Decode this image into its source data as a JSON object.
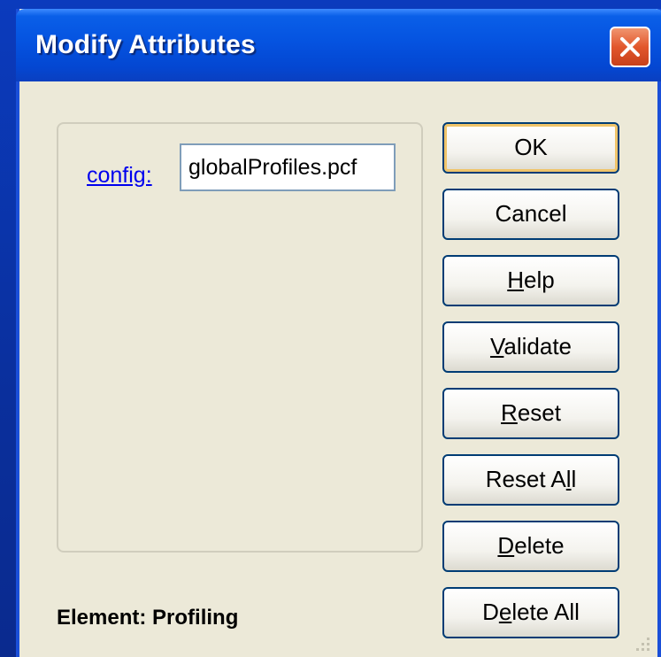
{
  "window": {
    "title": "Modify Attributes"
  },
  "attribute": {
    "label": "config:",
    "value": "globalProfiles.pcf"
  },
  "buttons": {
    "ok": "OK",
    "cancel": "Cancel",
    "help_pre": "",
    "help_ul": "H",
    "help_post": "elp",
    "validate_pre": "",
    "validate_ul": "V",
    "validate_post": "alidate",
    "reset_pre": "",
    "reset_ul": "R",
    "reset_post": "eset",
    "reset_all_pre": "Reset A",
    "reset_all_ul": "l",
    "reset_all_post": "l",
    "delete_pre": "",
    "delete_ul": "D",
    "delete_post": "elete",
    "delete_all_pre": "D",
    "delete_all_ul": "e",
    "delete_all_post": "lete All"
  },
  "status": {
    "element": "Element: Profiling"
  },
  "icons": {
    "close": "close-icon",
    "resize": "resize-grip-icon"
  },
  "colors": {
    "titlebar": "#0553e0",
    "close_button": "#e2572c",
    "dialog_bg": "#ece9d8",
    "link": "#0000ee"
  }
}
